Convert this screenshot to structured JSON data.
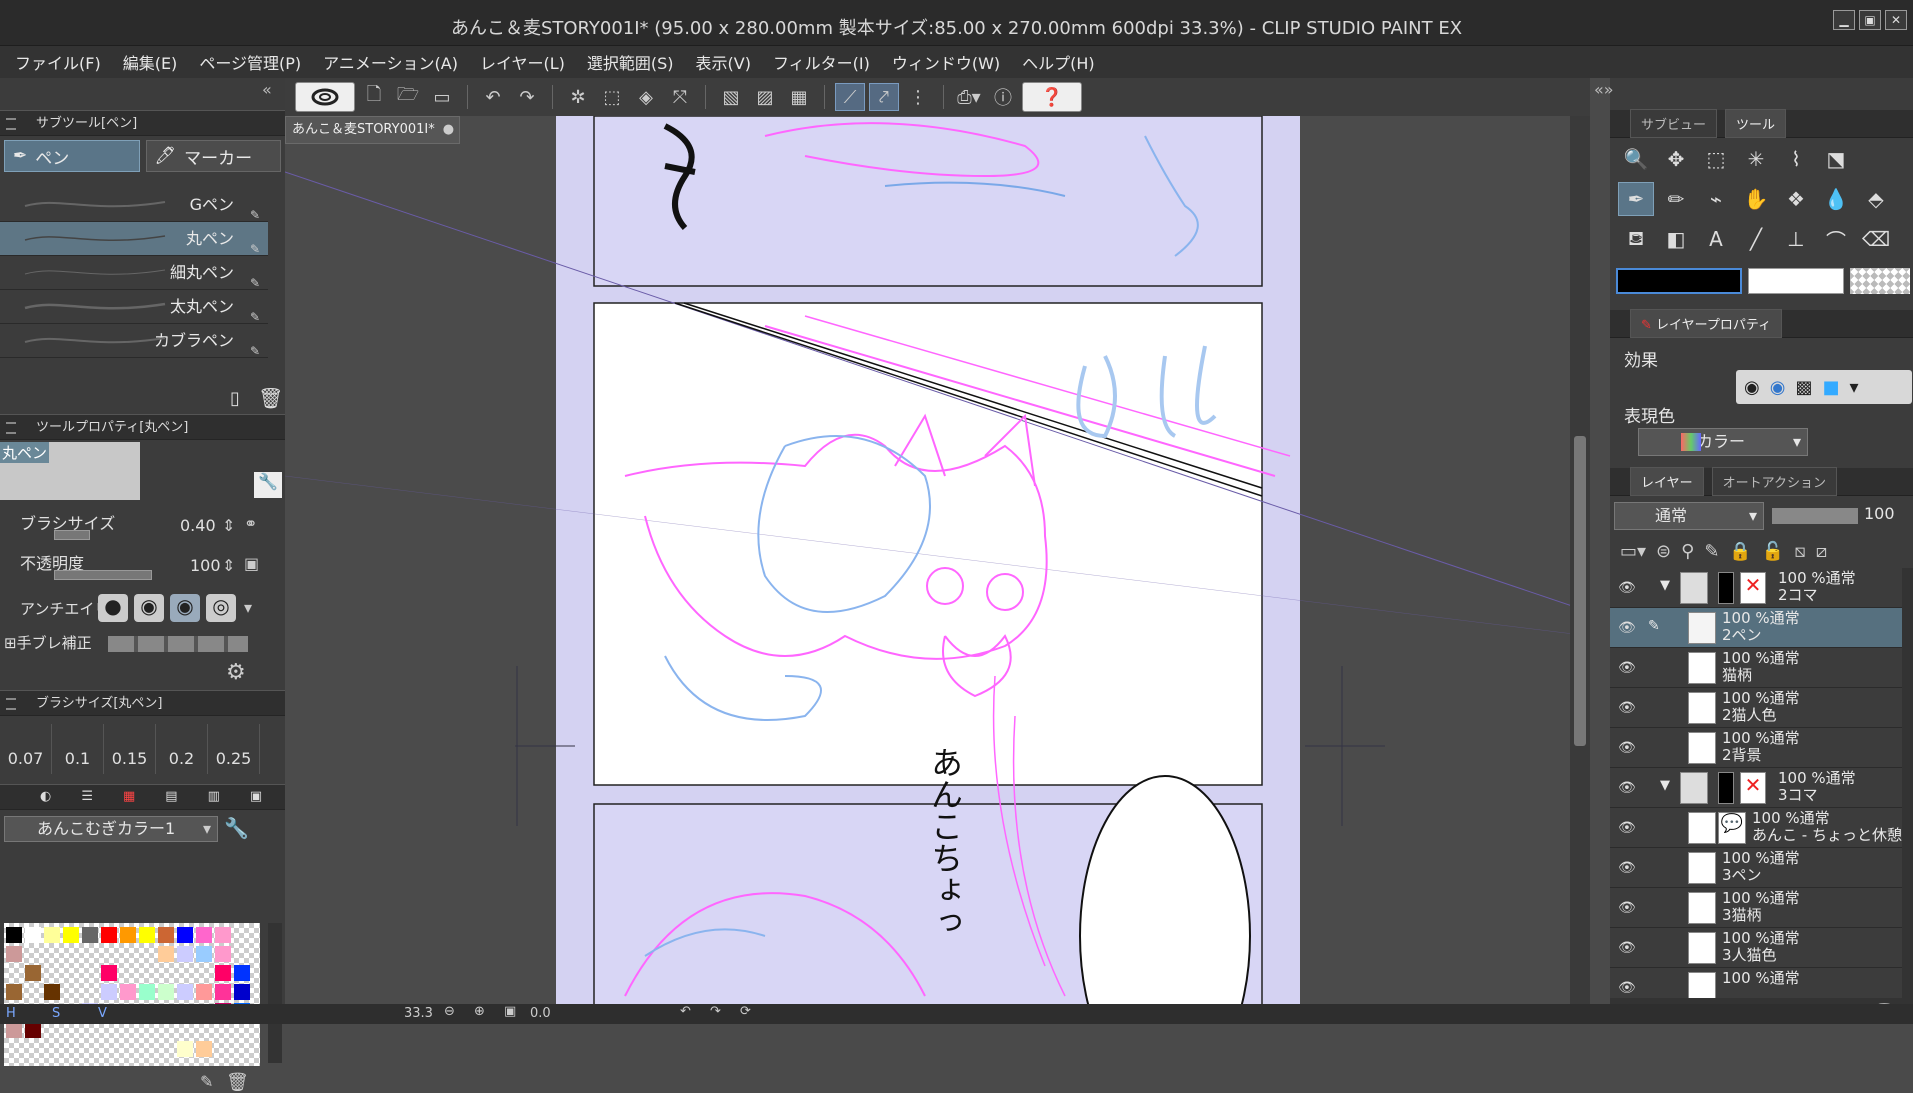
{
  "window": {
    "title": "あんこ＆麦STORY001I* (95.00 x 280.00mm 製本サイズ:85.00 x 270.00mm 600dpi 33.3%)  - CLIP STUDIO PAINT EX"
  },
  "menu": [
    "ファイル(F)",
    "編集(E)",
    "ページ管理(P)",
    "アニメーション(A)",
    "レイヤー(L)",
    "選択範囲(S)",
    "表示(V)",
    "フィルター(I)",
    "ウィンドウ(W)",
    "ヘルプ(H)"
  ],
  "document_tab": "あんこ＆麦STORY001I*",
  "subtool": {
    "header": "サブツール[ペン]",
    "tabs": [
      "ペン",
      "マーカー"
    ],
    "brushes": [
      "Gペン",
      "丸ペン",
      "細丸ペン",
      "太丸ペン",
      "カブラペン"
    ],
    "selected_brush": "丸ペン"
  },
  "tool_property": {
    "header": "ツールプロパティ[丸ペン]",
    "preview_label": "丸ペン",
    "brush_size_label": "ブラシサイズ",
    "brush_size_value": "0.40",
    "opacity_label": "不透明度",
    "opacity_value": "100",
    "antialias_label": "アンチエイリ",
    "stabilizer_label": "手ブレ補正"
  },
  "brush_size_panel": {
    "header": "ブラシサイズ[丸ペン]",
    "sizes": [
      "0.07",
      "0.1",
      "0.15",
      "0.2",
      "0.25"
    ]
  },
  "color_set": {
    "name": "あんこむぎカラー1",
    "swatches": [
      [
        "#000000",
        "#ffffff",
        "#ffff99",
        "#ffff00",
        "#666666",
        "#ff0000",
        "#ff9900",
        "#ffff00",
        "#cc6633",
        "#0000ff",
        "#ff66cc",
        "#ff99cc"
      ],
      [
        "#cc9999",
        "",
        "",
        "",
        "",
        "",
        "",
        "",
        "#ffcc99",
        "#ccccff",
        "#99ccff",
        "#ff99cc"
      ],
      [
        "",
        "#996633",
        "",
        "",
        "",
        "#ff0066",
        "",
        "",
        "",
        "",
        "",
        "#ff0066",
        "#0033ff"
      ],
      [
        "#996633",
        "",
        "#663300",
        "",
        "",
        "#ccccff",
        "#ff99cc",
        "#99ffcc",
        "#ccffcc",
        "#ccccff",
        "#ff9999",
        "#ff3399",
        "#0000cc"
      ],
      [
        "",
        "",
        "",
        "",
        "#ccccff",
        "",
        "",
        "",
        "",
        "",
        "",
        "#cc0066",
        "#0066ff"
      ],
      [
        "#cc9999",
        "#660000",
        "",
        "",
        "",
        "",
        "",
        "",
        "",
        "",
        "",
        "",
        ""
      ],
      [
        "",
        "",
        "",
        "",
        "",
        "",
        "",
        "",
        "",
        "#ffffcc",
        "#ffcc99",
        "",
        ""
      ]
    ]
  },
  "canvas": {
    "zoom": "33.3",
    "rotation": "0.0",
    "page_text": "あんこちょっ"
  },
  "right": {
    "subview_tab": "サブビュー",
    "tool_tab": "ツール",
    "layer_property_header": "レイヤープロパティ",
    "effect_label": "効果",
    "expression_label": "表現色",
    "expression_value": "カラー",
    "layer_tab": "レイヤー",
    "auto_action_tab": "オートアクション",
    "blend_mode": "通常",
    "layer_opacity": "100",
    "colors": {
      "main": "#000000",
      "sub": "#ffffff"
    }
  },
  "layers": [
    {
      "line1": "100 %通常",
      "line2": "2コマ",
      "folder": true,
      "selected": false
    },
    {
      "line1": "100 %通常",
      "line2": "2ペン",
      "folder": false,
      "selected": true
    },
    {
      "line1": "100 %通常",
      "line2": "猫柄",
      "folder": false,
      "selected": false
    },
    {
      "line1": "100 %通常",
      "line2": "2猫人色",
      "folder": false,
      "selected": false
    },
    {
      "line1": "100 %通常",
      "line2": "2背景",
      "folder": false,
      "selected": false
    },
    {
      "line1": "100 %通常",
      "line2": "3コマ",
      "folder": true,
      "selected": false
    },
    {
      "line1": "100 %通常",
      "line2": "あんこ - ちょっと休憩",
      "folder": false,
      "selected": false
    },
    {
      "line1": "100 %通常",
      "line2": "3ペン",
      "folder": false,
      "selected": false
    },
    {
      "line1": "100 %通常",
      "line2": "3猫柄",
      "folder": false,
      "selected": false
    },
    {
      "line1": "100 %通常",
      "line2": "3人猫色",
      "folder": false,
      "selected": false
    },
    {
      "line1": "100 %通常",
      "line2": "",
      "folder": false,
      "selected": false
    }
  ],
  "status": {
    "h": "H",
    "s": "S",
    "v": "V"
  }
}
